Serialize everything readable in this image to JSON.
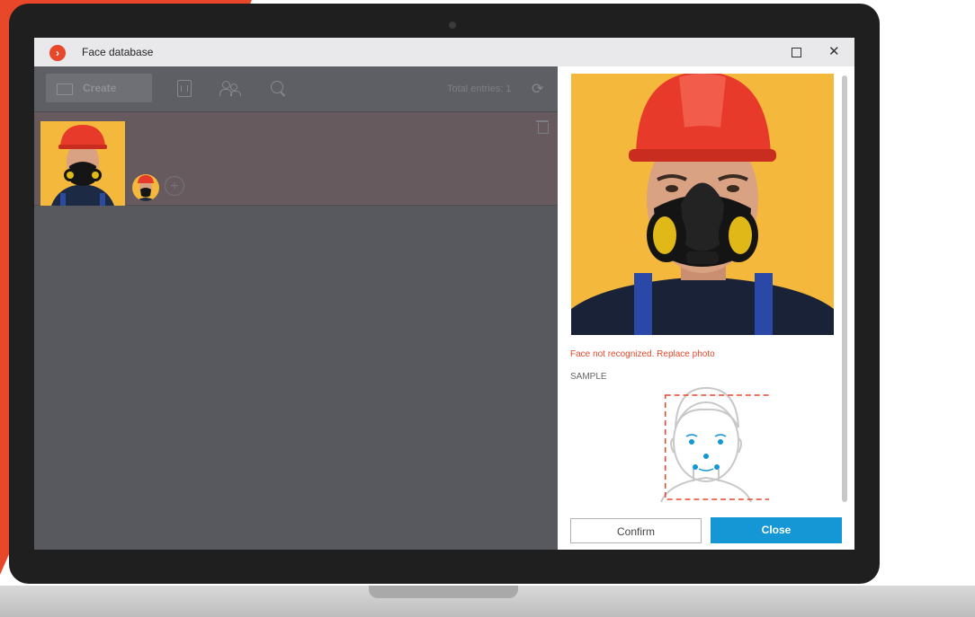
{
  "window": {
    "title": "Face database",
    "logo_glyph": "›",
    "maximize_icon": "maximize-icon",
    "close_glyph": "✕"
  },
  "toolbar": {
    "create_label": "Create",
    "total_entries": "Total entries: 1",
    "refresh_glyph": "⟳"
  },
  "entry": {
    "add_glyph": "+"
  },
  "detail": {
    "error_message": "Face not recognized. Replace photo",
    "sample_label": "SAMPLE",
    "confirm_label": "Confirm",
    "close_label": "Close"
  },
  "colors": {
    "accent": "#e8472a",
    "primary_button": "#1596d5",
    "photo_background": "#f4b83c",
    "helmet": "#e83a2a"
  }
}
